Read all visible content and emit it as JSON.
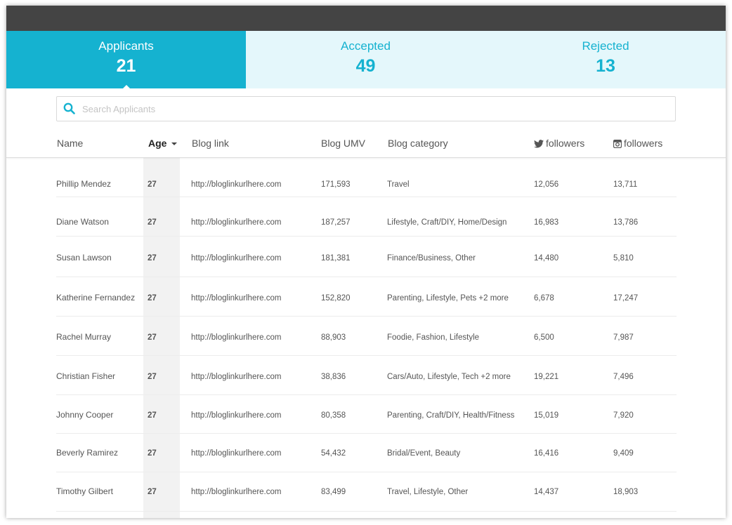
{
  "tabs": [
    {
      "label": "Applicants",
      "count": "21"
    },
    {
      "label": "Accepted",
      "count": "49"
    },
    {
      "label": "Rejected",
      "count": "13"
    }
  ],
  "search": {
    "placeholder": "Search Applicants"
  },
  "table": {
    "headers": {
      "name": "Name",
      "age": "Age",
      "blog_link": "Blog link",
      "blog_umv": "Blog UMV",
      "blog_category": "Blog category",
      "twitter_followers": "followers",
      "instagram_followers": "followers"
    },
    "rows": [
      {
        "name": "Phillip Mendez",
        "age": "27",
        "link": "http://bloglinkurlhere.com",
        "umv": "171,593",
        "category": "Travel",
        "twitter": "12,056",
        "instagram": "13,711"
      },
      {
        "name": "Diane Watson",
        "age": "27",
        "link": "http://bloglinkurlhere.com",
        "umv": "187,257",
        "category": "Lifestyle, Craft/DIY, Home/Design",
        "twitter": "16,983",
        "instagram": "13,786"
      },
      {
        "name": "Susan Lawson",
        "age": "27",
        "link": "http://bloglinkurlhere.com",
        "umv": "181,381",
        "category": "Finance/Business, Other",
        "twitter": "14,480",
        "instagram": "5,810"
      },
      {
        "name": "Katherine Fernandez",
        "age": "27",
        "link": "http://bloglinkurlhere.com",
        "umv": "152,820",
        "category": "Parenting, Lifestyle, Pets +2 more",
        "twitter": "6,678",
        "instagram": "17,247"
      },
      {
        "name": "Rachel Murray",
        "age": "27",
        "link": "http://bloglinkurlhere.com",
        "umv": "88,903",
        "category": "Foodie, Fashion, Lifestyle",
        "twitter": "6,500",
        "instagram": "7,987"
      },
      {
        "name": "Christian Fisher",
        "age": "27",
        "link": "http://bloglinkurlhere.com",
        "umv": "38,836",
        "category": "Cars/Auto, Lifestyle, Tech +2 more",
        "twitter": "19,221",
        "instagram": "7,496"
      },
      {
        "name": "Johnny Cooper",
        "age": "27",
        "link": "http://bloglinkurlhere.com",
        "umv": "80,358",
        "category": "Parenting, Craft/DIY, Health/Fitness",
        "twitter": "15,019",
        "instagram": "7,920"
      },
      {
        "name": "Beverly Ramirez",
        "age": "27",
        "link": "http://bloglinkurlhere.com",
        "umv": "54,432",
        "category": "Bridal/Event, Beauty",
        "twitter": "16,416",
        "instagram": "9,409"
      },
      {
        "name": "Timothy Gilbert",
        "age": "27",
        "link": "http://bloglinkurlhere.com",
        "umv": "83,499",
        "category": "Travel, Lifestyle, Other",
        "twitter": "14,437",
        "instagram": "18,903"
      }
    ]
  },
  "colors": {
    "accent": "#15b2d0",
    "tab_bg": "#e4f7fb",
    "titlebar": "#444444"
  },
  "icons": {
    "search": "search-icon",
    "twitter": "twitter-icon",
    "instagram": "instagram-icon",
    "sort": "caret-down-icon"
  }
}
